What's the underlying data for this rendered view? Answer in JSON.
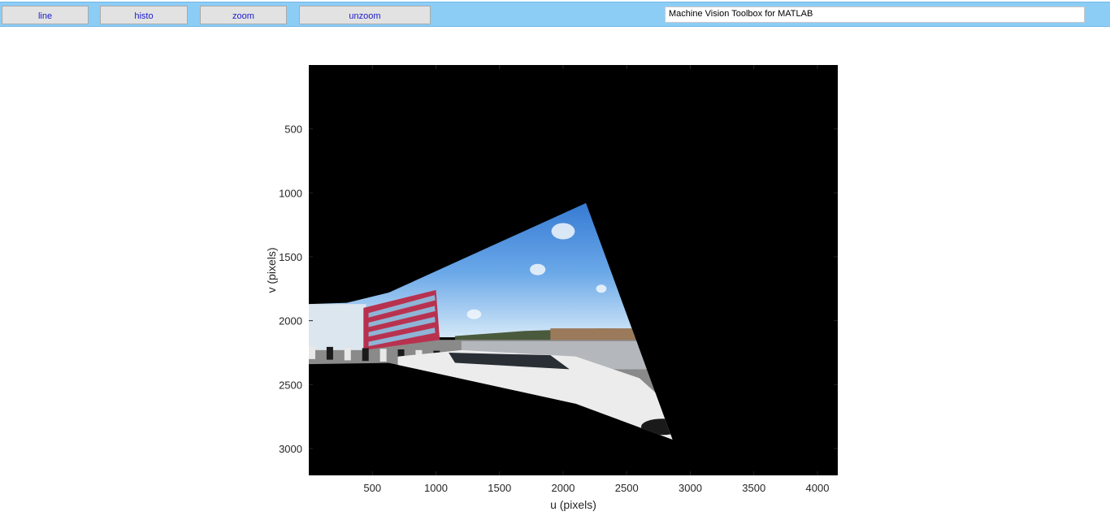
{
  "toolbar": {
    "buttons": [
      "line",
      "histo",
      "zoom",
      "unzoom"
    ],
    "title": "Machine Vision Toolbox for MATLAB",
    "background_color": "#8ccdf6"
  },
  "axes": {
    "xlabel": "u (pixels)",
    "ylabel": "v (pixels)",
    "xlim": [
      0,
      4160
    ],
    "ylim": [
      0,
      3210
    ],
    "ydir": "reversed",
    "x_ticks": [
      500,
      1000,
      1500,
      2000,
      2500,
      3000,
      3500,
      4000
    ],
    "y_ticks": [
      500,
      1000,
      1500,
      2000,
      2500,
      3000
    ],
    "background_color": "#000000"
  },
  "image": {
    "description_type": "warped panorama",
    "outline": [
      [
        0,
        1870
      ],
      [
        300,
        1860
      ],
      [
        630,
        1780
      ],
      [
        2180,
        1080
      ],
      [
        2860,
        2930
      ],
      [
        2100,
        2650
      ],
      [
        630,
        2330
      ],
      [
        0,
        2340
      ]
    ],
    "horizon_v": 2130,
    "colors": {
      "sky_top": "#3b7fd6",
      "sky_bottom": "#c7e1f7",
      "building": "#b8324f",
      "car": "#ececec",
      "ground": "#8a8a8a"
    }
  }
}
